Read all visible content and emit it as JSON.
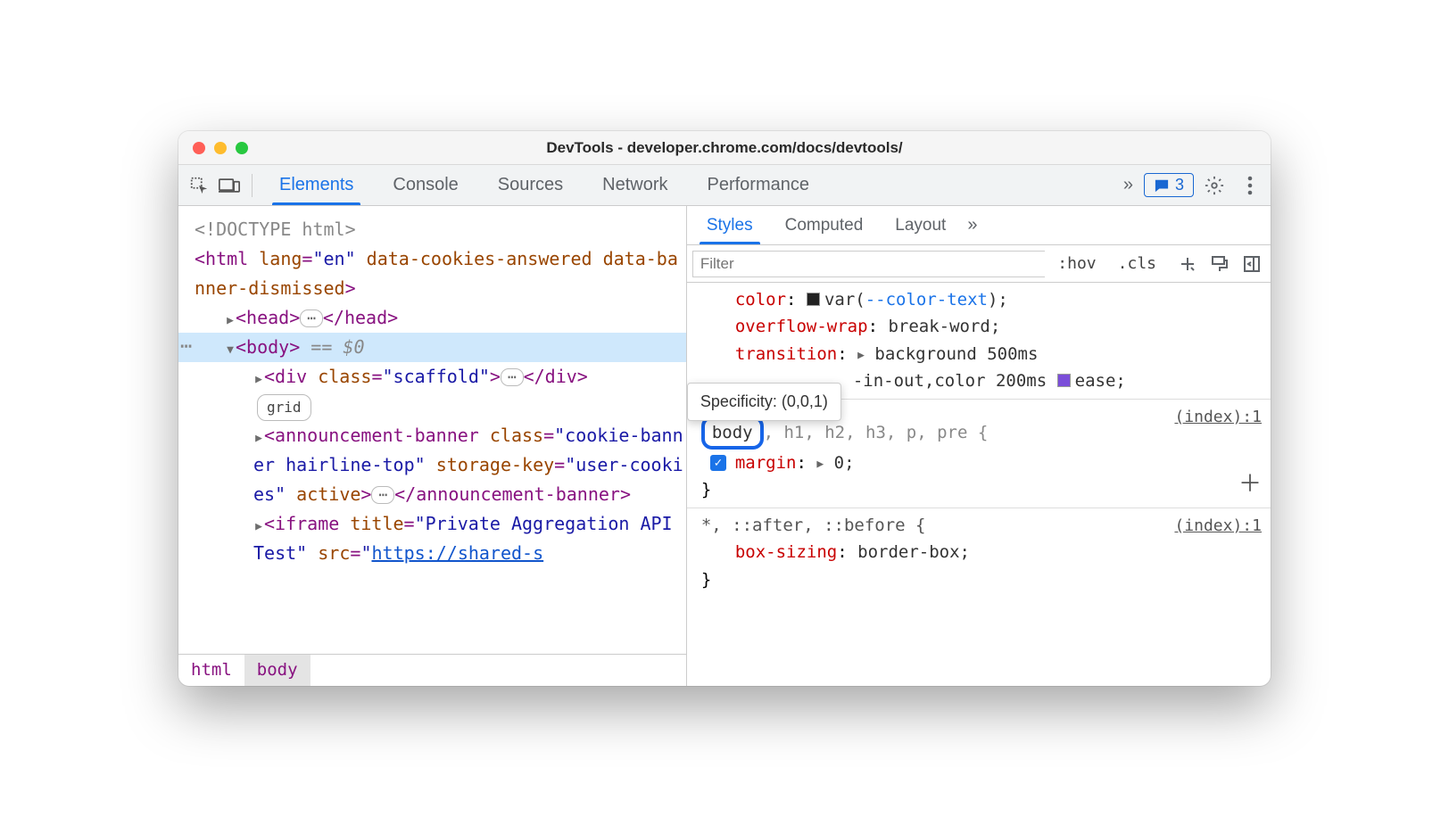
{
  "window": {
    "title": "DevTools - developer.chrome.com/docs/devtools/"
  },
  "toolbar": {
    "tabs": [
      "Elements",
      "Console",
      "Sources",
      "Network",
      "Performance"
    ],
    "active_tab": 0,
    "issues_count": "3"
  },
  "dom": {
    "doctype": "<!DOCTYPE html>",
    "html_open_prefix": "<html ",
    "html_lang_name": "lang",
    "html_lang_val": "\"en\"",
    "html_attrs_rest": " data-cookies-answered data-banner-dismissed",
    "html_close": ">",
    "head_open": "<head>",
    "head_close": "</head>",
    "body_open": "<body>",
    "body_marker": " == $0",
    "div_open": "<div ",
    "class_name": "class",
    "scaffold_val": "\"scaffold\"",
    "div_open_end": ">",
    "div_close": "</div>",
    "grid_label": "grid",
    "abanner_open": "<announcement-banner ",
    "cookie_class_val": "\"cookie-banner hairline-top\"",
    "storage_key_name": " storage-key",
    "storage_key_val": "\"user-cookies\"",
    "active_attr": " active",
    "abanner_open_end": ">",
    "abanner_close": "</announcement-banner>",
    "iframe_open": "<iframe ",
    "title_attr": "title",
    "iframe_title_val": "\"Private Aggregation API Test\"",
    "src_attr": " src",
    "iframe_src_val": "https://shared-s",
    "ellipsis": "⋯"
  },
  "breadcrumbs": {
    "items": [
      "html",
      "body"
    ],
    "selected": 1
  },
  "sub_tabs": {
    "items": [
      "Styles",
      "Computed",
      "Layout"
    ],
    "active": 0
  },
  "filter": {
    "placeholder": "Filter",
    "hov": ":hov",
    "cls": ".cls"
  },
  "styles": {
    "rule0": {
      "p_color_name": "color",
      "p_color_val": "var(",
      "p_color_var": "--color-text",
      "p_color_end": ");",
      "p_ow_name": "overflow-wrap",
      "p_ow_val": "break-word;",
      "p_tr_name": "transition",
      "p_tr_val1": "background 500ms",
      "p_tr_val2": "-in-out,color 200ms ",
      "p_tr_ease": "ease;"
    },
    "tooltip": "Specificity: (0,0,1)",
    "rule1": {
      "sel_body": "body",
      "sel_rest": ", h1, h2, h3, p, pre {",
      "margin_name": "margin",
      "margin_val": "0;",
      "close": "}",
      "src": "(index):1"
    },
    "rule2": {
      "selector": "*, ::after, ::before {",
      "bs_name": "box-sizing",
      "bs_val": "border-box;",
      "close": "}",
      "src": "(index):1"
    }
  }
}
